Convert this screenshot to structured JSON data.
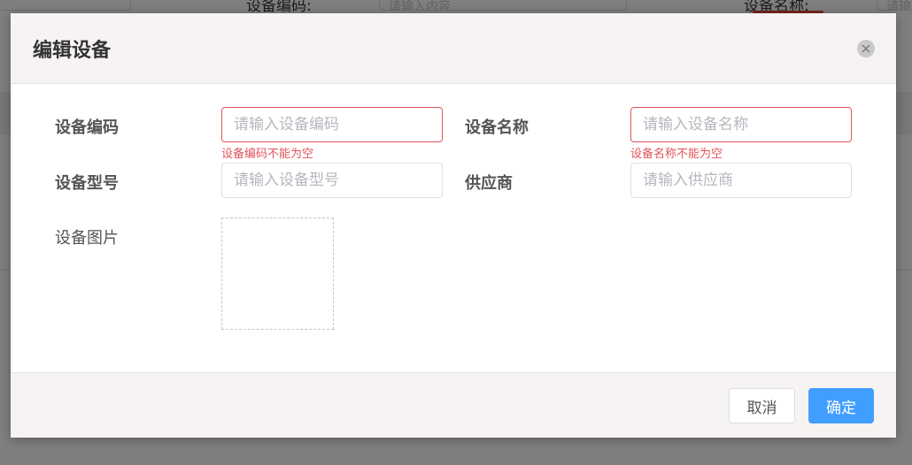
{
  "background": {
    "filters": [
      {
        "label": "设备编码:",
        "placeholder": "请输入内容"
      },
      {
        "label": "设备名称:",
        "placeholder": "请输"
      }
    ]
  },
  "dialog": {
    "title": "编辑设备",
    "fields": {
      "code": {
        "label": "设备编码",
        "placeholder": "请输入设备编码",
        "value": "",
        "error": "设备编码不能为空"
      },
      "name": {
        "label": "设备名称",
        "placeholder": "请输入设备名称",
        "value": "",
        "error": "设备名称不能为空"
      },
      "model": {
        "label": "设备型号",
        "placeholder": "请输入设备型号",
        "value": ""
      },
      "supplier": {
        "label": "供应商",
        "placeholder": "请输入供应商",
        "value": ""
      },
      "image": {
        "label": "设备图片"
      }
    },
    "buttons": {
      "cancel": "取消",
      "confirm": "确定"
    }
  },
  "colors": {
    "primary": "#409eff",
    "error": "#e2545a",
    "header_bg": "#f7f3f2"
  },
  "icons": {
    "close": "close-icon"
  }
}
